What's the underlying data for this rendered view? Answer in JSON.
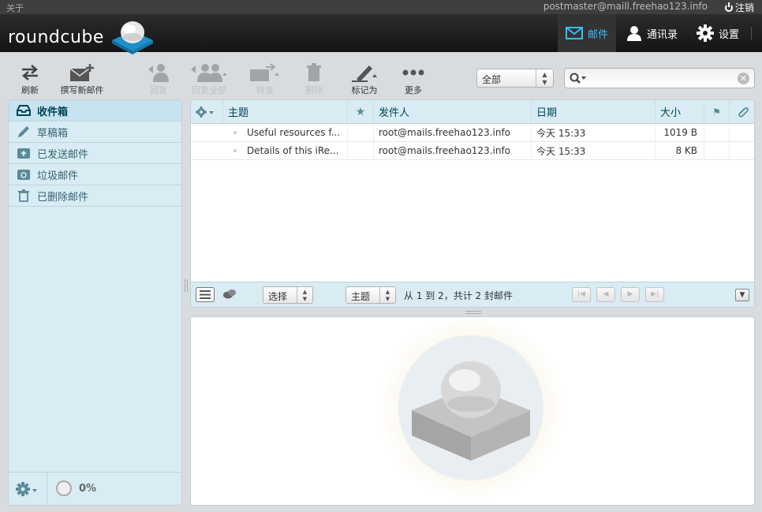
{
  "topline": {
    "about": "关于",
    "username": "postmaster@maill.freehao123.info",
    "logout": "注销"
  },
  "header": {
    "logo_text": "roundcube",
    "tasks": {
      "mail": "邮件",
      "contacts": "通讯录",
      "settings": "设置"
    }
  },
  "toolbar": {
    "refresh": "刷新",
    "compose": "撰写新邮件",
    "reply": "回复",
    "reply_all": "回复全部",
    "forward": "转发",
    "delete": "删除",
    "mark": "标记为",
    "more": "更多"
  },
  "quickfilter": {
    "selected": "全部"
  },
  "search": {
    "placeholder": ""
  },
  "folders": [
    {
      "name": "收件箱",
      "icon": "inbox-icon",
      "selected": true
    },
    {
      "name": "草稿箱",
      "icon": "pencil-icon",
      "selected": false
    },
    {
      "name": "已发送邮件",
      "icon": "sent-icon",
      "selected": false
    },
    {
      "name": "垃圾邮件",
      "icon": "junk-icon",
      "selected": false
    },
    {
      "name": "已删除邮件",
      "icon": "trash-icon",
      "selected": false
    }
  ],
  "quota": {
    "value": "0%"
  },
  "messagelist": {
    "columns": {
      "subject": "主题",
      "from": "发件人",
      "date": "日期",
      "size": "大小"
    },
    "rows": [
      {
        "subject": "Useful resources f...",
        "from": "root@mails.freehao123.info",
        "date": "今天 15:33",
        "size": "1019 B"
      },
      {
        "subject": "Details of this iRe...",
        "from": "root@mails.freehao123.info",
        "date": "今天 15:33",
        "size": "8 KB"
      }
    ],
    "footer": {
      "select_label": "选择",
      "threads_label": "主题",
      "count_text": "从 1 到 2，共计 2 封邮件"
    }
  },
  "colors": {
    "accent": "#37beff",
    "panel": "#d9ecf4",
    "folder_text": "#376572"
  }
}
